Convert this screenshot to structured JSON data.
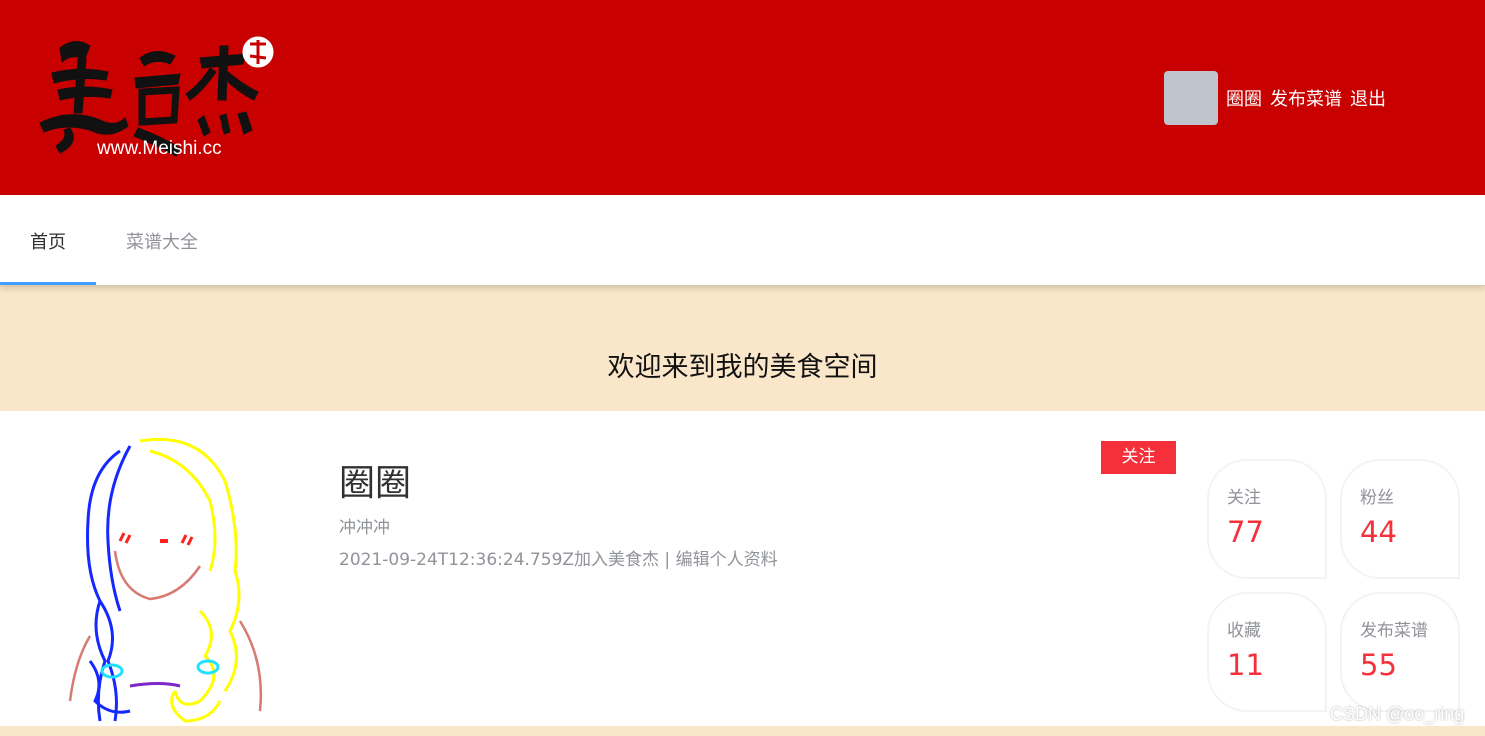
{
  "header": {
    "logo_url": "www.Meishi.cc",
    "user": {
      "name": "圈圈",
      "publish_label": "发布菜谱",
      "logout_label": "退出"
    }
  },
  "nav": {
    "tabs": [
      {
        "label": "首页",
        "active": true
      },
      {
        "label": "菜谱大全",
        "active": false
      }
    ]
  },
  "welcome": {
    "title": "欢迎来到我的美食空间"
  },
  "profile": {
    "name": "圈圈",
    "signature": "冲冲冲",
    "joined_text": "2021-09-24T12:36:24.759Z加入美食杰",
    "separator": " | ",
    "edit_label": "编辑个人资料",
    "follow_button": "关注",
    "stats": {
      "follow": {
        "label": "关注",
        "value": "77"
      },
      "fans": {
        "label": "粉丝",
        "value": "44"
      },
      "collect": {
        "label": "收藏",
        "value": "11"
      },
      "publish": {
        "label": "发布菜谱",
        "value": "55"
      }
    }
  },
  "watermark": "CSDN @oo_ring",
  "colors": {
    "header_bg": "#c90000",
    "welcome_bg": "#fae7c9",
    "accent_red": "#f5303a",
    "tab_underline": "#409eff"
  }
}
